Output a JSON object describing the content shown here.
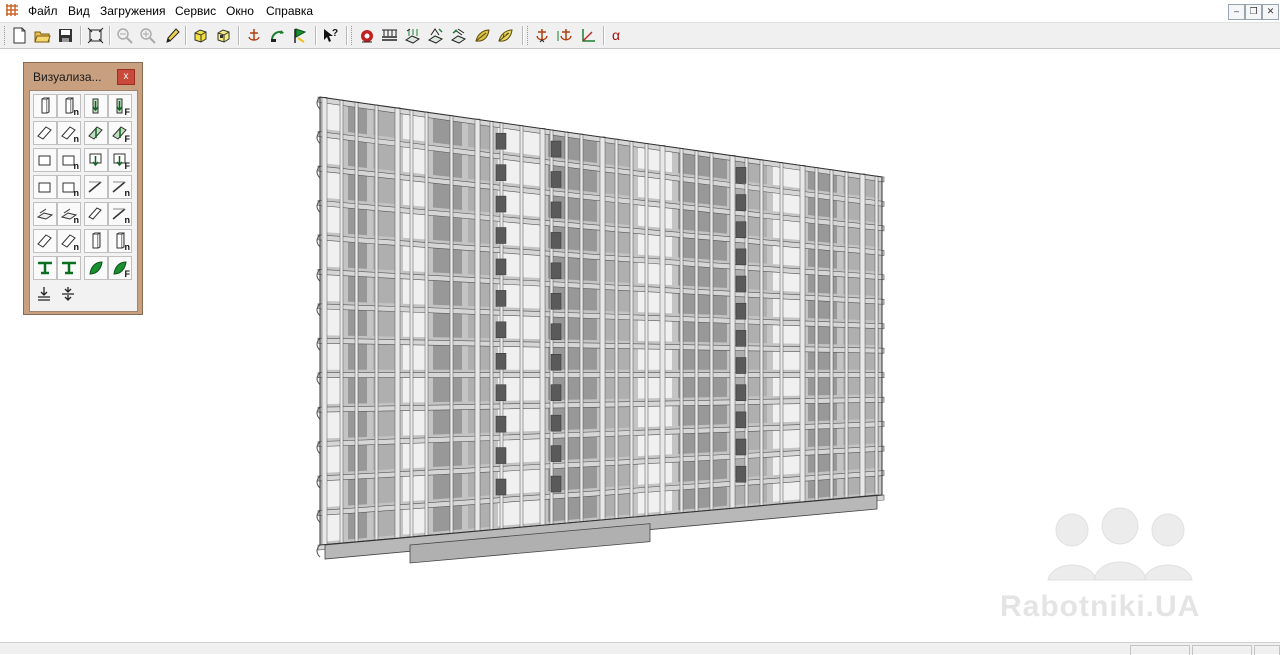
{
  "app": {
    "icon": "grid-app-icon"
  },
  "menu": [
    "Файл",
    "Вид",
    "Загружения",
    "Сервис",
    "Окно",
    "Справка"
  ],
  "window_controls": {
    "minimize": "–",
    "restore": "❐",
    "close": "✕"
  },
  "toolbar": {
    "icons": [
      "new-document-icon",
      "open-folder-icon",
      "save-icon",
      "fit-view-icon",
      "zoom-out-icon",
      "zoom-in-icon",
      "pencil-icon",
      "cube-icon",
      "cube-outline-icon",
      "anchor-icon",
      "rotate-icon",
      "flag-icon",
      "help-pointer-icon",
      "load-icon",
      "beam-load-icon",
      "slab-load-icon",
      "temperature-load-icon",
      "leaf-load-icon",
      "leaf-outline-icon",
      "support-icon",
      "support-alt-icon",
      "axes-icon"
    ],
    "alpha_label": "α"
  },
  "visualization_panel": {
    "title": "Визуализа...",
    "close_label": "x",
    "subscript_n": "n",
    "subscript_f": "F"
  },
  "model": {
    "type": "3d-building-frame",
    "floors": 13
  },
  "watermark": {
    "text": "Rabotniki.UA"
  }
}
